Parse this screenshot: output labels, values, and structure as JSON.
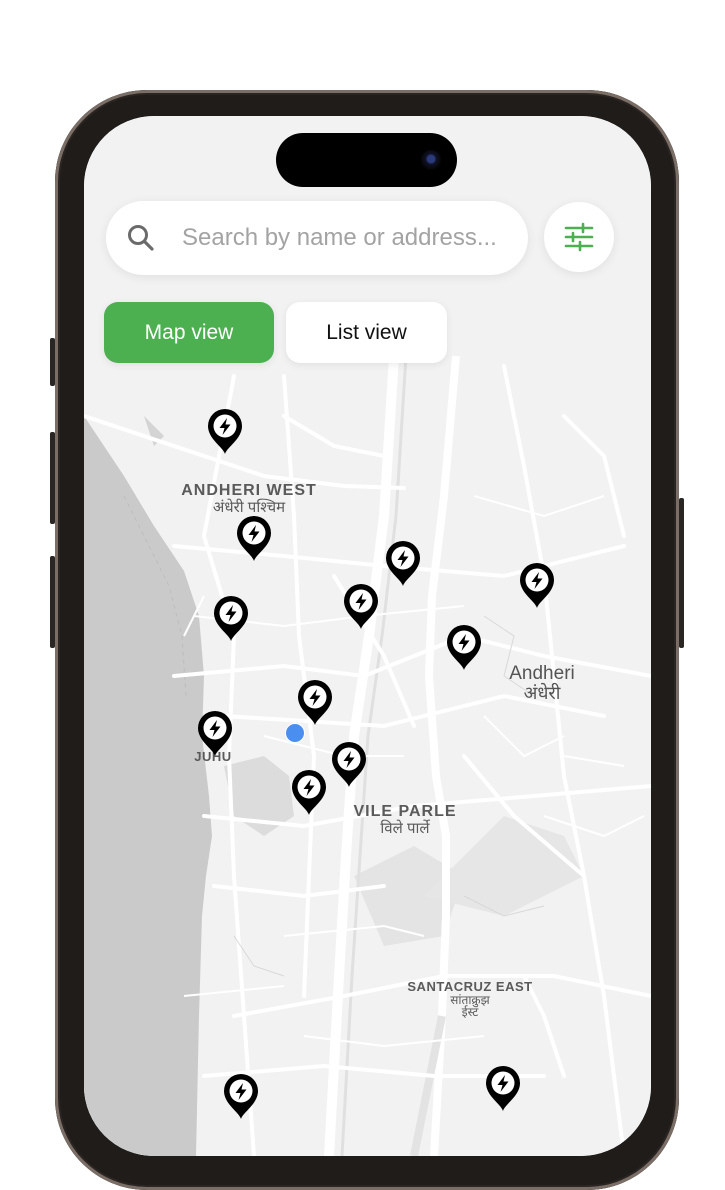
{
  "search": {
    "placeholder": "Search by name or address..."
  },
  "view_toggle": {
    "map_label": "Map view",
    "list_label": "List view",
    "active": "map"
  },
  "map": {
    "labels": {
      "andheri_west_en": "ANDHERI WEST",
      "andheri_west_hi": "अंधेरी पश्चिम",
      "andheri_en": "Andheri",
      "andheri_hi": "अंधेरी",
      "juhu_en": "JUHU",
      "vile_parle_en": "VILE PARLE",
      "vile_parle_hi": "विले पार्ले",
      "santacruz_en": "SANTACRUZ EAST",
      "santacruz_hi1": "सांताक्रुझ",
      "santacruz_hi2": "ईस्ट"
    }
  },
  "colors": {
    "accent": "#4caf50",
    "user_location": "#4a8ff0",
    "pin": "#000000"
  },
  "icons": [
    "search-icon",
    "filter-sliders-icon",
    "charging-station-pin-icon",
    "lightning-bolt-icon"
  ]
}
